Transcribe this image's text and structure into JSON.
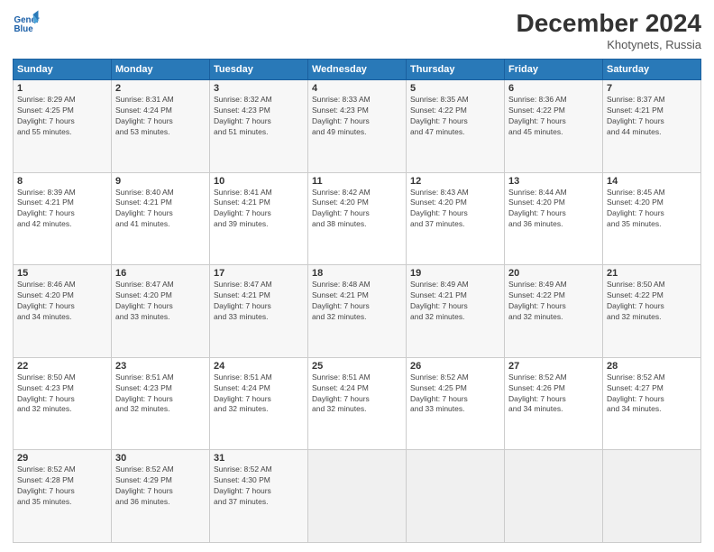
{
  "header": {
    "logo_line1": "General",
    "logo_line2": "Blue",
    "month": "December 2024",
    "location": "Khotynets, Russia"
  },
  "weekdays": [
    "Sunday",
    "Monday",
    "Tuesday",
    "Wednesday",
    "Thursday",
    "Friday",
    "Saturday"
  ],
  "weeks": [
    [
      {
        "day": "1",
        "info": "Sunrise: 8:29 AM\nSunset: 4:25 PM\nDaylight: 7 hours\nand 55 minutes."
      },
      {
        "day": "2",
        "info": "Sunrise: 8:31 AM\nSunset: 4:24 PM\nDaylight: 7 hours\nand 53 minutes."
      },
      {
        "day": "3",
        "info": "Sunrise: 8:32 AM\nSunset: 4:23 PM\nDaylight: 7 hours\nand 51 minutes."
      },
      {
        "day": "4",
        "info": "Sunrise: 8:33 AM\nSunset: 4:23 PM\nDaylight: 7 hours\nand 49 minutes."
      },
      {
        "day": "5",
        "info": "Sunrise: 8:35 AM\nSunset: 4:22 PM\nDaylight: 7 hours\nand 47 minutes."
      },
      {
        "day": "6",
        "info": "Sunrise: 8:36 AM\nSunset: 4:22 PM\nDaylight: 7 hours\nand 45 minutes."
      },
      {
        "day": "7",
        "info": "Sunrise: 8:37 AM\nSunset: 4:21 PM\nDaylight: 7 hours\nand 44 minutes."
      }
    ],
    [
      {
        "day": "8",
        "info": "Sunrise: 8:39 AM\nSunset: 4:21 PM\nDaylight: 7 hours\nand 42 minutes."
      },
      {
        "day": "9",
        "info": "Sunrise: 8:40 AM\nSunset: 4:21 PM\nDaylight: 7 hours\nand 41 minutes."
      },
      {
        "day": "10",
        "info": "Sunrise: 8:41 AM\nSunset: 4:21 PM\nDaylight: 7 hours\nand 39 minutes."
      },
      {
        "day": "11",
        "info": "Sunrise: 8:42 AM\nSunset: 4:20 PM\nDaylight: 7 hours\nand 38 minutes."
      },
      {
        "day": "12",
        "info": "Sunrise: 8:43 AM\nSunset: 4:20 PM\nDaylight: 7 hours\nand 37 minutes."
      },
      {
        "day": "13",
        "info": "Sunrise: 8:44 AM\nSunset: 4:20 PM\nDaylight: 7 hours\nand 36 minutes."
      },
      {
        "day": "14",
        "info": "Sunrise: 8:45 AM\nSunset: 4:20 PM\nDaylight: 7 hours\nand 35 minutes."
      }
    ],
    [
      {
        "day": "15",
        "info": "Sunrise: 8:46 AM\nSunset: 4:20 PM\nDaylight: 7 hours\nand 34 minutes."
      },
      {
        "day": "16",
        "info": "Sunrise: 8:47 AM\nSunset: 4:20 PM\nDaylight: 7 hours\nand 33 minutes."
      },
      {
        "day": "17",
        "info": "Sunrise: 8:47 AM\nSunset: 4:21 PM\nDaylight: 7 hours\nand 33 minutes."
      },
      {
        "day": "18",
        "info": "Sunrise: 8:48 AM\nSunset: 4:21 PM\nDaylight: 7 hours\nand 32 minutes."
      },
      {
        "day": "19",
        "info": "Sunrise: 8:49 AM\nSunset: 4:21 PM\nDaylight: 7 hours\nand 32 minutes."
      },
      {
        "day": "20",
        "info": "Sunrise: 8:49 AM\nSunset: 4:22 PM\nDaylight: 7 hours\nand 32 minutes."
      },
      {
        "day": "21",
        "info": "Sunrise: 8:50 AM\nSunset: 4:22 PM\nDaylight: 7 hours\nand 32 minutes."
      }
    ],
    [
      {
        "day": "22",
        "info": "Sunrise: 8:50 AM\nSunset: 4:23 PM\nDaylight: 7 hours\nand 32 minutes."
      },
      {
        "day": "23",
        "info": "Sunrise: 8:51 AM\nSunset: 4:23 PM\nDaylight: 7 hours\nand 32 minutes."
      },
      {
        "day": "24",
        "info": "Sunrise: 8:51 AM\nSunset: 4:24 PM\nDaylight: 7 hours\nand 32 minutes."
      },
      {
        "day": "25",
        "info": "Sunrise: 8:51 AM\nSunset: 4:24 PM\nDaylight: 7 hours\nand 32 minutes."
      },
      {
        "day": "26",
        "info": "Sunrise: 8:52 AM\nSunset: 4:25 PM\nDaylight: 7 hours\nand 33 minutes."
      },
      {
        "day": "27",
        "info": "Sunrise: 8:52 AM\nSunset: 4:26 PM\nDaylight: 7 hours\nand 34 minutes."
      },
      {
        "day": "28",
        "info": "Sunrise: 8:52 AM\nSunset: 4:27 PM\nDaylight: 7 hours\nand 34 minutes."
      }
    ],
    [
      {
        "day": "29",
        "info": "Sunrise: 8:52 AM\nSunset: 4:28 PM\nDaylight: 7 hours\nand 35 minutes."
      },
      {
        "day": "30",
        "info": "Sunrise: 8:52 AM\nSunset: 4:29 PM\nDaylight: 7 hours\nand 36 minutes."
      },
      {
        "day": "31",
        "info": "Sunrise: 8:52 AM\nSunset: 4:30 PM\nDaylight: 7 hours\nand 37 minutes."
      },
      {
        "day": "",
        "info": ""
      },
      {
        "day": "",
        "info": ""
      },
      {
        "day": "",
        "info": ""
      },
      {
        "day": "",
        "info": ""
      }
    ]
  ]
}
